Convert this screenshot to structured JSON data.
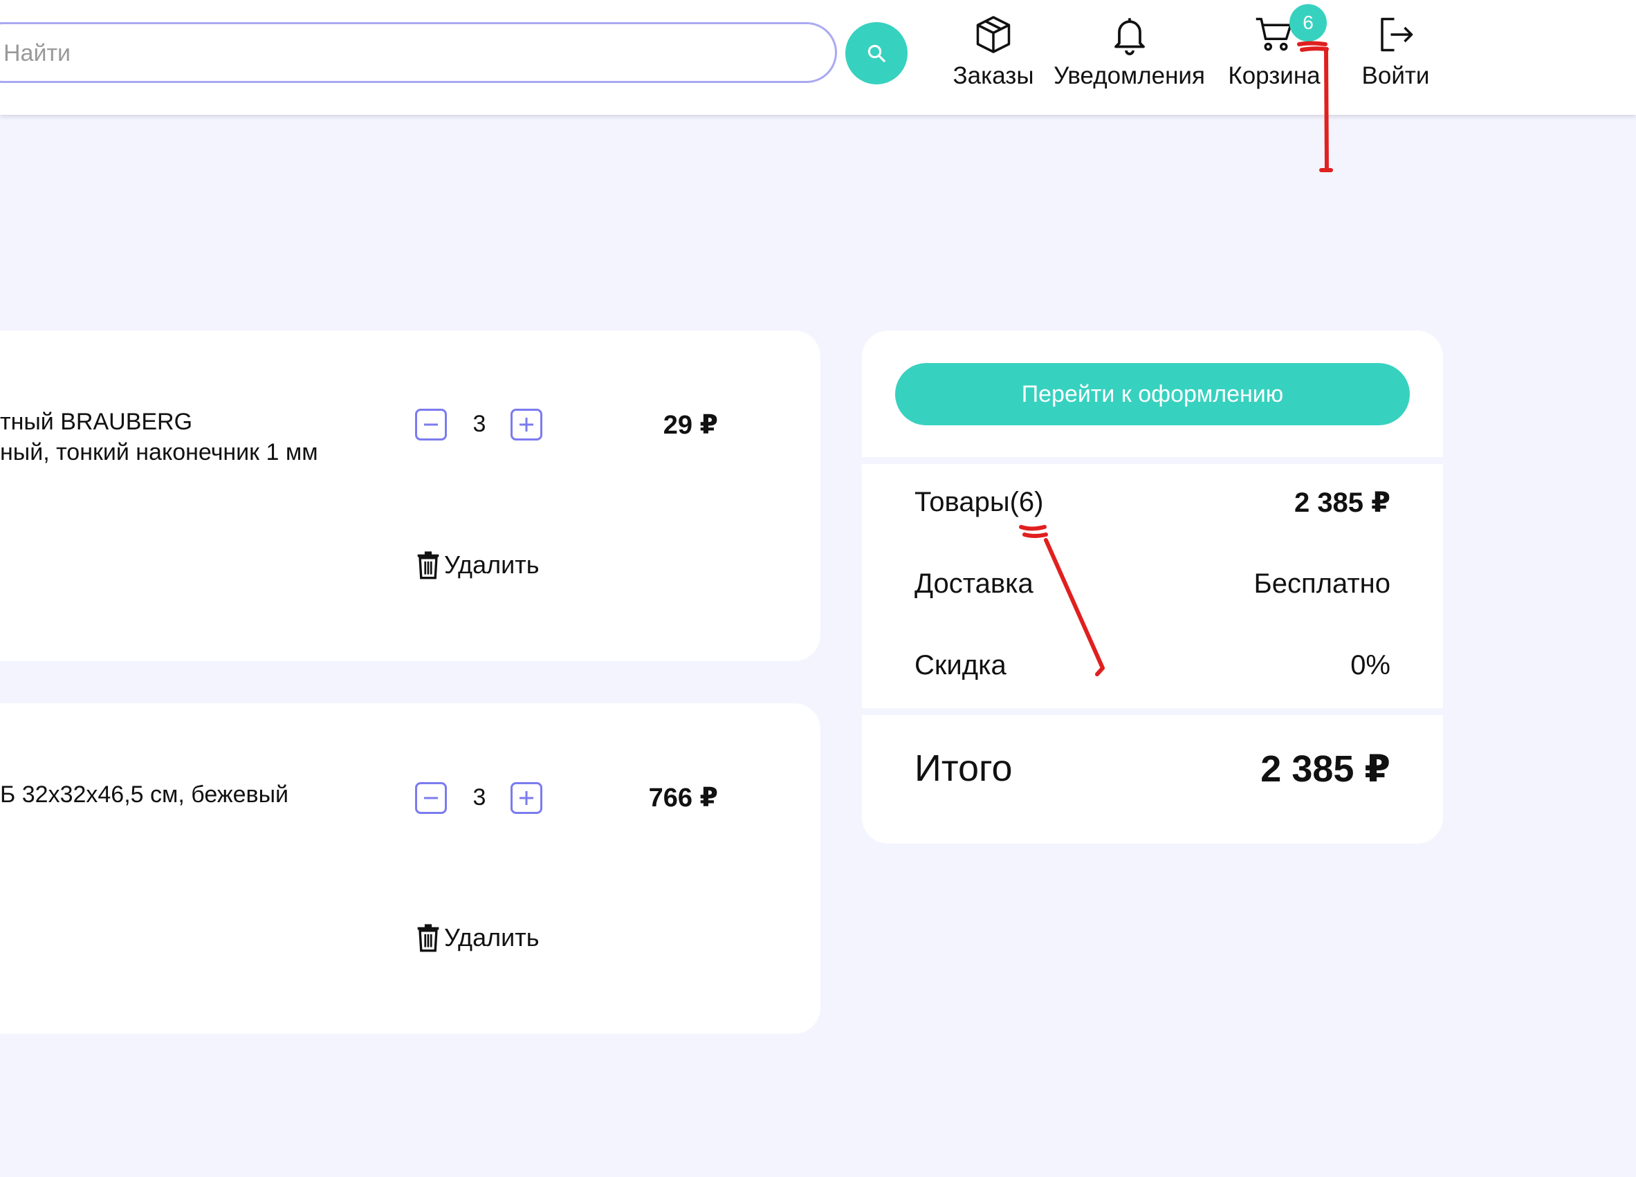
{
  "header": {
    "search": {
      "placeholder": "Найти"
    },
    "nav": {
      "orders_label": "Заказы",
      "notifications_label": "Уведомления",
      "cart_label": "Корзина",
      "cart_count": "6",
      "login_label": "Войти"
    }
  },
  "cart": {
    "items": [
      {
        "title_line1": "тный BRAUBERG",
        "title_line2": "ный, тонкий наконечник 1 мм",
        "quantity": "3",
        "price": "29 ₽",
        "delete_label": "Удалить"
      },
      {
        "title_line1": "Б 32x32x46,5 см, бежевый",
        "quantity": "3",
        "price": "766 ₽",
        "delete_label": "Удалить"
      }
    ]
  },
  "summary": {
    "checkout_label": "Перейти к оформлению",
    "goods_label": "Товары(6)",
    "goods_value": "2 385 ₽",
    "delivery_label": "Доставка",
    "delivery_value": "Бесплатно",
    "discount_label": "Скидка",
    "discount_value": "0%",
    "total_label": "Итого",
    "total_value": "2 385 ₽"
  },
  "colors": {
    "accent": "#37d1bf",
    "background": "#f4f4ff",
    "qty_border": "#7b7bf0",
    "annotation": "#e0201f"
  }
}
